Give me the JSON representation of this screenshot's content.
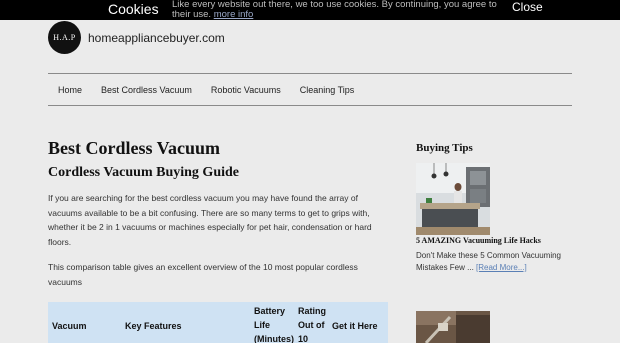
{
  "cookie": {
    "title": "Cookies",
    "message": "Like every website out there, we too use cookies. By continuing, you agree to their use.",
    "more_link": "more info",
    "close_label": "Close"
  },
  "header": {
    "logo_text": "H.A.P",
    "site_name": "homeappliancebuyer.com"
  },
  "nav": {
    "items": [
      "Home",
      "Best Cordless Vacuum",
      "Robotic Vacuums",
      "Cleaning Tips"
    ]
  },
  "main": {
    "title": "Best Cordless Vacuum",
    "subtitle": "Cordless Vacuum Buying Guide",
    "paragraph1": "If you are searching for the best cordless vacuum you may have found the array of vacuums available to be a bit confusing. There are so many terms to get to grips with, whether it be 2 in 1 vacuums or machines especially for pet hair, condensation or hard floors.",
    "paragraph2": "This comparison table gives an excellent overview of the 10 most popular cordless vacuums",
    "table": {
      "headers": [
        "Vacuum",
        "Key Features",
        "Battery Life (Minutes)",
        "Rating Out of 10",
        "Get it Here"
      ]
    }
  },
  "sidebar": {
    "title": "Buying Tips",
    "post_title": "5 AMAZING Vacuuming Life Hacks",
    "excerpt": "Don't Make these 5 Common Vacuuming Mistakes Few ...",
    "read_more": "[Read More...]"
  }
}
